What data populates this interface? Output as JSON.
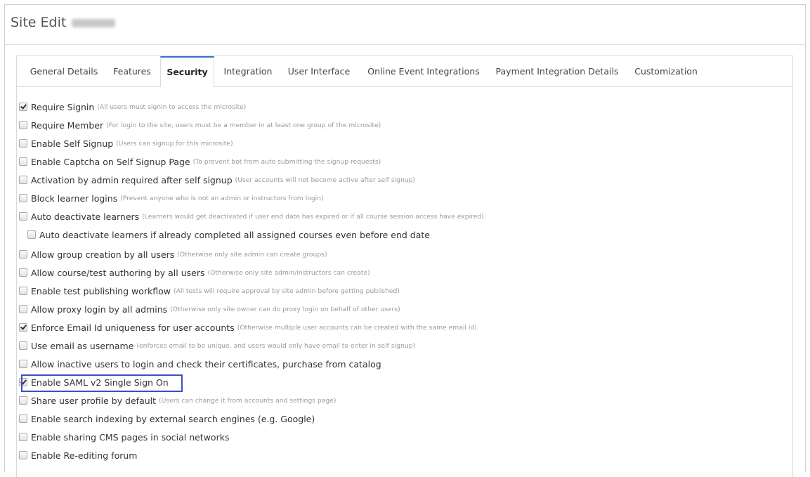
{
  "page": {
    "title": "Site Edit"
  },
  "tabs": [
    {
      "label": "General Details"
    },
    {
      "label": "Features"
    },
    {
      "label": "Security"
    },
    {
      "label": "Integration"
    },
    {
      "label": "User Interface"
    },
    {
      "label": "Online Event Integrations"
    },
    {
      "label": "Payment Integration Details"
    },
    {
      "label": "Customization"
    }
  ],
  "active_tab": "Security",
  "options": [
    {
      "label": "Require Signin",
      "hint": "(All users must signin to access the microsite)",
      "checked": true
    },
    {
      "label": "Require Member",
      "hint": "(For login to the site, users must be a member in at least one group of the microsite)",
      "checked": false
    },
    {
      "label": "Enable Self Signup",
      "hint": "(Users can signup for this microsite)",
      "checked": false
    },
    {
      "label": "Enable Captcha on Self Signup Page",
      "hint": "(To prevent bot from auto submitting the signup requests)",
      "checked": false
    },
    {
      "label": "Activation by admin required after self signup",
      "hint": "(User accounts will not become active after self signup)",
      "checked": false
    },
    {
      "label": "Block learner logins",
      "hint": "(Prevent anyone who is not an admin or instructors from login)",
      "checked": false
    },
    {
      "label": "Auto deactivate learners",
      "hint": "(Learners would get deactivated if user end date has expired or if all course session access have expired)",
      "checked": false
    },
    {
      "label": "Auto deactivate learners if already completed all assigned courses even before end date",
      "hint": "",
      "checked": false,
      "indent": true
    },
    {
      "label": "Allow group creation by all users",
      "hint": "(Otherwise only site admin can create groups)",
      "checked": false
    },
    {
      "label": "Allow course/test authoring by all users",
      "hint": "(Otherwise only site admin/instructors can create)",
      "checked": false
    },
    {
      "label": "Enable test publishing workflow",
      "hint": "(All tests will require approval by site admin before getting published)",
      "checked": false
    },
    {
      "label": "Allow proxy login by all admins",
      "hint": "(Otherwise only site owner can do proxy login on behalf of other users)",
      "checked": false
    },
    {
      "label": "Enforce Email Id uniqueness for user accounts",
      "hint": "(Otherwise multiple user accounts can be created with the same email id)",
      "checked": true
    },
    {
      "label": "Use email as username",
      "hint": "(enforces email to be unique, and users would only have email to enter in self signup)",
      "checked": false
    },
    {
      "label": "Allow inactive users to login and check their certificates, purchase from catalog",
      "hint": "",
      "checked": false
    },
    {
      "label": "Enable SAML v2 Single Sign On",
      "hint": "",
      "checked": true,
      "highlighted": true
    },
    {
      "label": "Share user profile by default",
      "hint": "(Users can change it from accounts and settings page)",
      "checked": false
    },
    {
      "label": "Enable search indexing by external search engines (e.g. Google)",
      "hint": "",
      "checked": false
    },
    {
      "label": "Enable sharing CMS pages in social networks",
      "hint": "",
      "checked": false
    },
    {
      "label": "Enable Re-editing forum",
      "hint": "",
      "checked": false
    }
  ]
}
